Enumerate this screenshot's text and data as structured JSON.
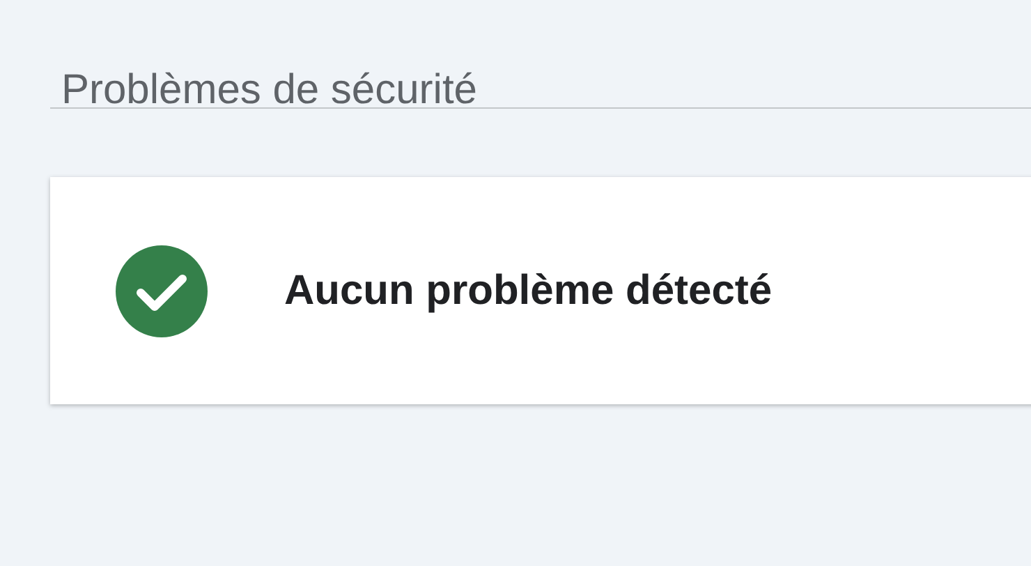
{
  "section": {
    "title": "Problèmes de sécurité"
  },
  "status_card": {
    "kind": "ok",
    "message": "Aucun problème détecté"
  }
}
